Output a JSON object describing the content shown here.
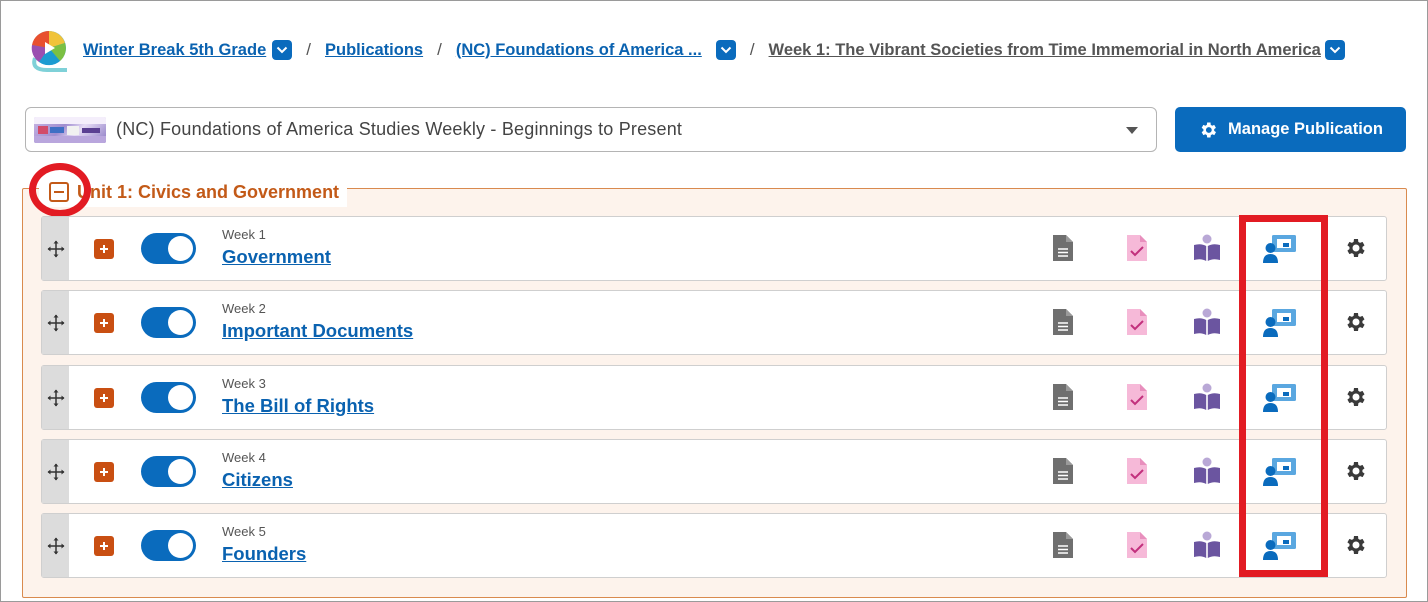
{
  "breadcrumb": {
    "class_name": "Winter Break 5th Grade",
    "publications": "Publications",
    "publication": "(NC) Foundations of America ...",
    "week": "Week 1: The Vibrant Societies from Time Immemorial in North America",
    "separator": "/"
  },
  "publication_select": {
    "value": "(NC) Foundations of America Studies Weekly - Beginnings to Present"
  },
  "manage_button": "Manage Publication",
  "unit": {
    "title": "Unit 1: Civics and Government"
  },
  "weeks": [
    {
      "label": "Week 1",
      "title": "Government",
      "enabled": true
    },
    {
      "label": "Week 2",
      "title": "Important Documents",
      "enabled": true
    },
    {
      "label": "Week 3",
      "title": "The Bill of Rights",
      "enabled": true
    },
    {
      "label": "Week 4",
      "title": "Citizens",
      "enabled": true
    },
    {
      "label": "Week 5",
      "title": "Founders",
      "enabled": true
    }
  ],
  "row_icons": [
    "document-icon",
    "assessment-check-icon",
    "reader-book-icon",
    "teacher-presentation-icon",
    "gear-icon"
  ],
  "colors": {
    "brand_blue": "#0a6bbd",
    "link_blue": "#0a62b0",
    "unit_orange": "#c35a18",
    "highlight_red": "#e21b23",
    "doc_gray": "#707070",
    "assessment_pink": "#e45aa6",
    "reader_purple": "#6b55a0",
    "gear_dark": "#3a3a3a"
  }
}
